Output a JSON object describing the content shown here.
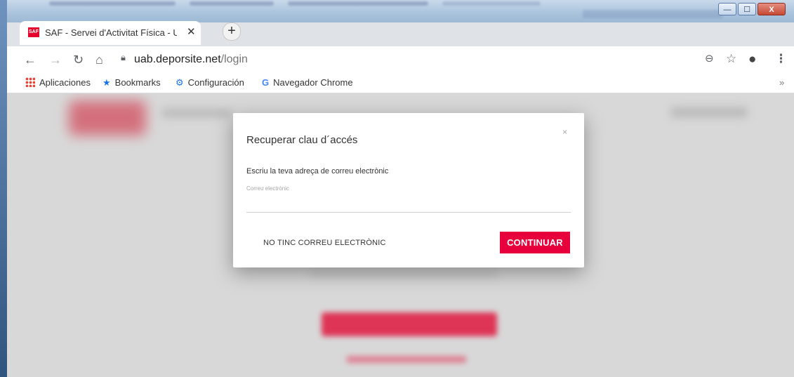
{
  "tab": {
    "favicon_text": "SAF",
    "title": "SAF - Servei d'Activitat Física - U",
    "close": "✕"
  },
  "toolbar": {
    "url_host": "uab.deporsite.net",
    "url_path": "/login"
  },
  "window_controls": {
    "minimize": "—",
    "maximize": "☐",
    "close": "X"
  },
  "bookmarks": [
    {
      "label": "Aplicaciones",
      "icon": "apps-grid-icon"
    },
    {
      "label": "Bookmarks",
      "icon": "star-icon"
    },
    {
      "label": "Configuración",
      "icon": "gear-icon"
    },
    {
      "label": "Navegador Chrome",
      "icon": "google-g-icon"
    }
  ],
  "modal": {
    "title": "Recuperar clau d´accés",
    "close": "×",
    "prompt": "Escriu la teva adreça de correu electrònic",
    "email_placeholder": "Correu electrònic",
    "email_value": "",
    "no_email_button": "NO TINC CORREU ELECTRÒNIC",
    "continue_button": "CONTINUAR"
  },
  "colors": {
    "accent": "#e8003d",
    "page_overlay": "#d8d8d8"
  }
}
